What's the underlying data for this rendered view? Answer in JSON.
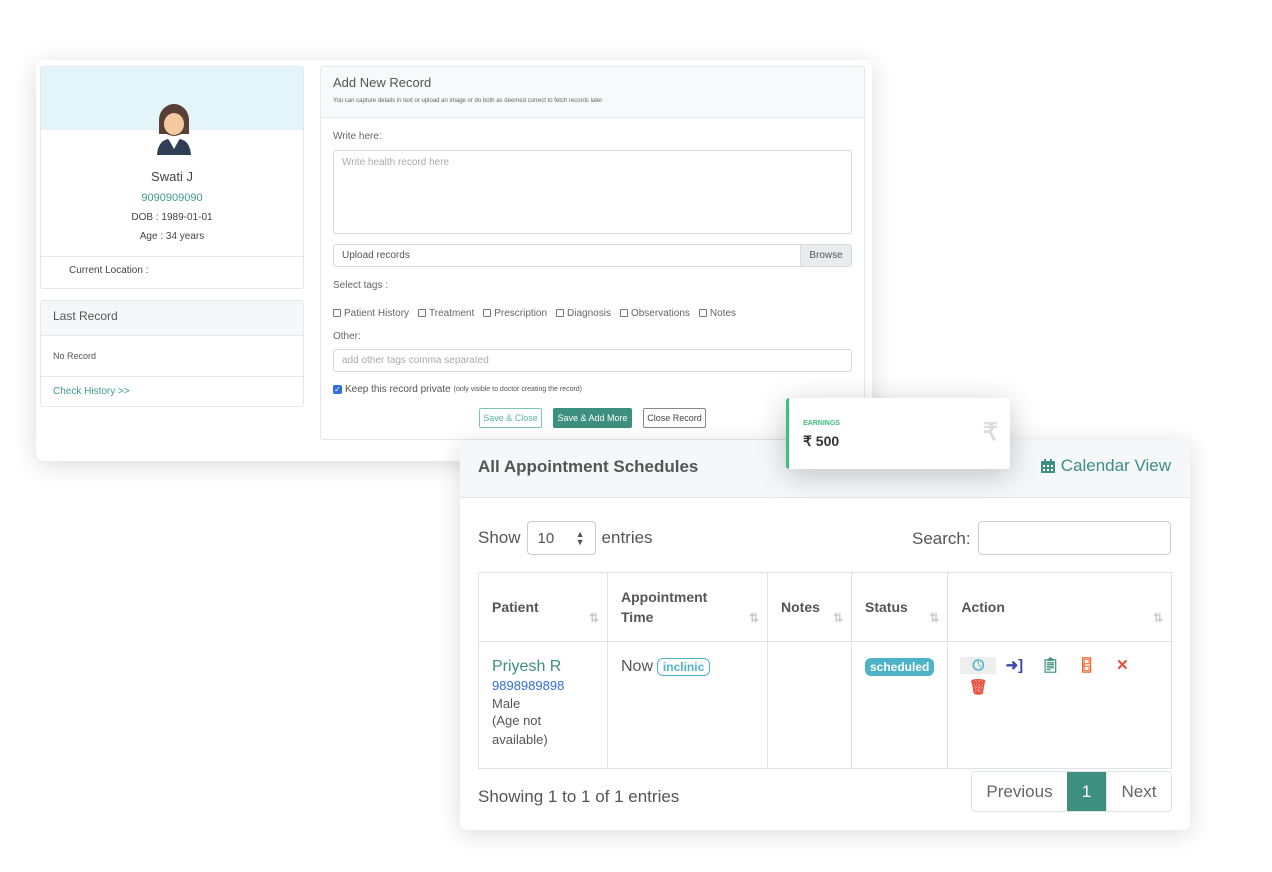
{
  "profile": {
    "name": "Swati J",
    "phone": "9090909090",
    "dob": "DOB : 1989-01-01",
    "age": "Age : 34 years",
    "location_label": "Current Location :"
  },
  "last_record": {
    "title": "Last Record",
    "value": "No Record",
    "link": "Check History >>"
  },
  "record_form": {
    "title": "Add New Record",
    "subtitle": "You can capture details in text or upload an image or do both as deemed correct to fetch records later.",
    "write_label": "Write here:",
    "write_placeholder": "Write health record here",
    "upload_label": "Upload records",
    "browse": "Browse",
    "tags_label": "Select tags :",
    "tags": [
      "Patient History",
      "Treatment",
      "Prescription",
      "Diagnosis",
      "Observations",
      "Notes"
    ],
    "other_label": "Other:",
    "other_placeholder": "add other tags comma separated",
    "private_label": "Keep this record private",
    "private_note": "(only visible to doctor creating the record)",
    "private_checked": true,
    "save_close": "Save & Close",
    "save_add": "Save & Add More",
    "close": "Close Record"
  },
  "earnings": {
    "label": "EARNINGS",
    "value": "₹ 500",
    "icon": "rupee-icon"
  },
  "appointments": {
    "title": "All Appointment Schedules",
    "calendar_view": "Calendar View",
    "show": "Show",
    "entries_value": "10",
    "entries": "entries",
    "search_label": "Search:",
    "columns": [
      "Patient",
      "Appointment Time",
      "Notes",
      "Status",
      "Action"
    ],
    "rows": [
      {
        "name": "Priyesh R",
        "phone": "9898989898",
        "gender": "Male",
        "age": "(Age not available)",
        "time": "Now",
        "badge": "inclinic",
        "notes": "",
        "status": "scheduled"
      }
    ],
    "footer": "Showing 1 to 1 of 1 entries",
    "pagination": {
      "previous": "Previous",
      "page": "1",
      "next": "Next"
    }
  },
  "colors": {
    "accent": "#3d8f7f",
    "status": "#4fb3c8",
    "danger": "#e74c3c",
    "indigo": "#3f48a8"
  }
}
